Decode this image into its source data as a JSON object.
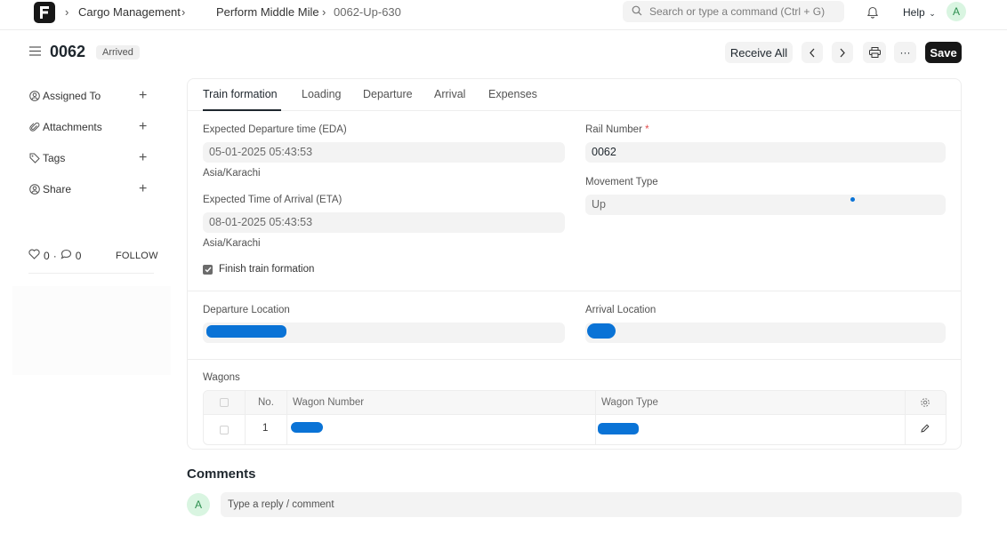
{
  "navbar": {
    "breadcrumbs": [
      "Cargo Management",
      "Perform Middle Mile",
      "0062-Up-630"
    ],
    "search_placeholder": "Search or type a command (Ctrl + G)",
    "help_label": "Help",
    "avatar_initial": "A"
  },
  "header": {
    "title": "0062",
    "status": "Arrived",
    "receive_all_label": "Receive All",
    "more_label": "···",
    "save_label": "Save"
  },
  "sidebar": {
    "items": [
      {
        "label": "Assigned To",
        "icon": "user-circle-icon"
      },
      {
        "label": "Attachments",
        "icon": "paperclip-icon"
      },
      {
        "label": "Tags",
        "icon": "tag-icon"
      },
      {
        "label": "Share",
        "icon": "share-user-icon"
      }
    ],
    "likes_count": "0",
    "comments_count": "0",
    "follow_label": "FOLLOW"
  },
  "tabs": [
    "Train formation",
    "Loading",
    "Departure",
    "Arrival",
    "Expenses"
  ],
  "active_tab": "Train formation",
  "form": {
    "eda_label": "Expected Departure time (EDA)",
    "eda_value": "05-01-2025 05:43:53",
    "eda_tz": "Asia/Karachi",
    "eta_label": "Expected Time of Arrival (ETA)",
    "eta_value": "08-01-2025 05:43:53",
    "eta_tz": "Asia/Karachi",
    "finish_label": "Finish train formation",
    "finish_checked": true,
    "rail_number_label": "Rail Number",
    "rail_number_required": "*",
    "rail_number_value": "0062",
    "movement_type_label": "Movement Type",
    "movement_type_value": "Up",
    "departure_location_label": "Departure Location",
    "arrival_location_label": "Arrival Location"
  },
  "wagons": {
    "label": "Wagons",
    "columns": [
      "No.",
      "Wagon Number",
      "Wagon Type"
    ],
    "rows": [
      {
        "no": "1"
      }
    ]
  },
  "comments": {
    "title": "Comments",
    "avatar_initial": "A",
    "placeholder": "Type a reply / comment"
  },
  "colors": {
    "primary_dark": "#171717",
    "redaction_blue": "#0a73d6",
    "field_bg": "#f3f3f3",
    "avatar_bg": "#d9f5e1",
    "avatar_fg": "#2d8f4f"
  }
}
